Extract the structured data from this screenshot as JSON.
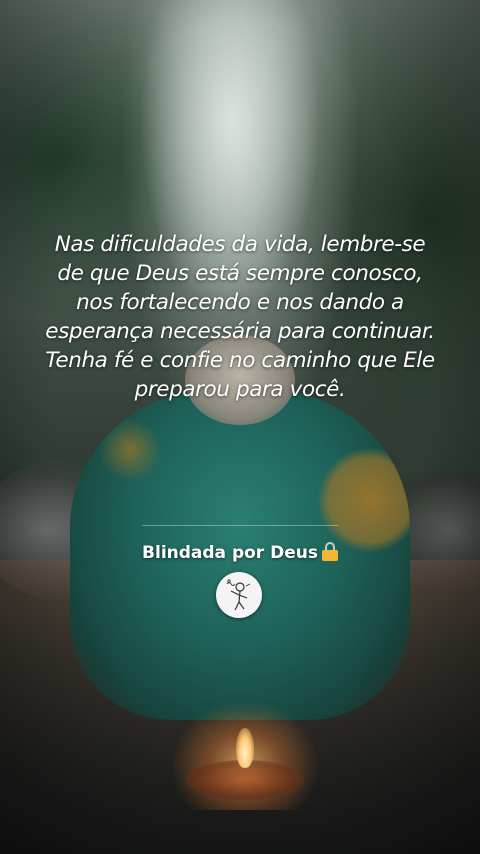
{
  "post": {
    "quote": "Nas dificuldades da vida, lembre-se de que Deus está sempre conosco, nos fortalecendo e nos dando a esperança necessária para continuar. Tenha fé e confie no caminho que Ele preparou para você.",
    "author_name": "Blindada por Deus",
    "author_icon": "lock-icon",
    "avatar_icon": "stick-figure-drawing"
  },
  "colors": {
    "text": "#ffffff",
    "lock_body": "#f1b632",
    "avatar_bg": "#f4f4f4"
  }
}
